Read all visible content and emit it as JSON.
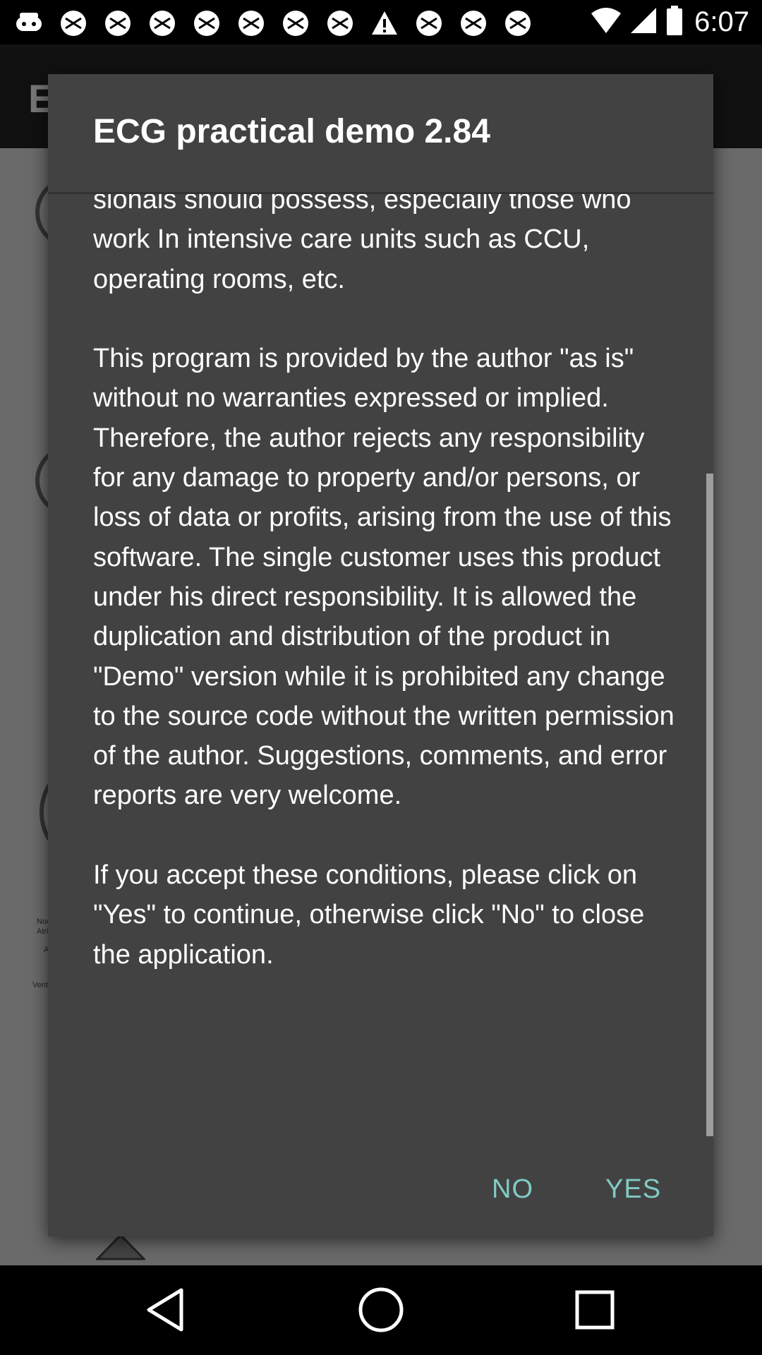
{
  "status_bar": {
    "time": "6:07",
    "icons": [
      "android-icon",
      "android-icon",
      "android-icon",
      "android-icon",
      "android-icon",
      "android-icon",
      "android-icon",
      "android-icon",
      "warning-icon",
      "android-icon",
      "android-icon",
      "android-icon"
    ]
  },
  "background_app": {
    "toolbar_letter": "E",
    "labels": [
      "Noc",
      "Atri",
      "A",
      "Vent"
    ]
  },
  "dialog": {
    "title": "ECG practical demo 2.84",
    "body_paragraphs": [
      "sionals should possess, especially those who work In intensive care units such as CCU, operating rooms, etc.",
      "This program is provided by the author \"as is\" without no warranties expressed or implied. Therefore, the author rejects any responsibility for any damage to property and/or persons, or loss of data or profits, arising from the use of this software. The single customer uses this product under his direct responsibility. It is allowed the duplication and distribution of the product in \"Demo\" version while it is prohibited any change to the source code without the written permission of the author. Suggestions, comments, and error reports are very welcome.",
      "If you accept these conditions, please click on \"Yes\" to continue, otherwise click \"No\" to close the application."
    ],
    "buttons": {
      "no": "NO",
      "yes": "YES"
    },
    "accent_color": "#80cbc4",
    "background_color": "#424242"
  },
  "nav_bar": {
    "icons": [
      "back-icon",
      "home-icon",
      "recent-apps-icon"
    ]
  }
}
